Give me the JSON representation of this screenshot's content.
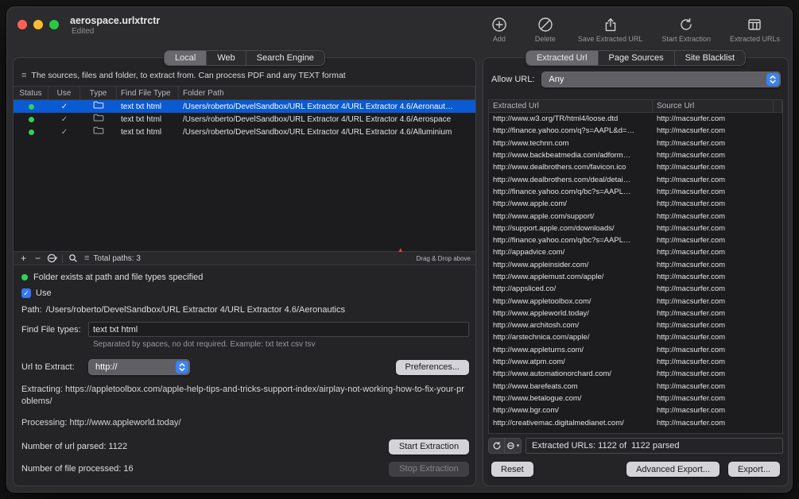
{
  "colors": {
    "accent_blue": "#3478f6",
    "selection_blue": "#0a5ad1",
    "status_green": "#30d158",
    "traffic_red": "#ff5f57",
    "traffic_yellow": "#febc2e",
    "traffic_green": "#28c840"
  },
  "window": {
    "title": "aerospace.urlxtrctr",
    "subtitle": "Edited"
  },
  "toolbar": {
    "items": [
      {
        "label": "Add",
        "icon": "plus-circle-icon"
      },
      {
        "label": "Delete",
        "icon": "slash-circle-icon"
      },
      {
        "label": "Save Extracted URL",
        "icon": "share-icon"
      },
      {
        "label": "Start Extraction",
        "icon": "refresh-icon"
      },
      {
        "label": "Extracted URLs",
        "icon": "table-columns-icon"
      }
    ]
  },
  "left_panel": {
    "tabs": [
      "Local",
      "Web",
      "Search Engine"
    ],
    "active_tab": "Local",
    "description": "The sources, files and folder, to extract from. Can process PDF and any TEXT format",
    "table": {
      "columns": [
        "Status",
        "Use",
        "Type",
        "Find File Type",
        "Folder Path"
      ],
      "rows": [
        {
          "status": "green",
          "use": true,
          "type": "folder",
          "find_file_type": "text txt html",
          "folder_path": "/Users/roberto/DevelSandbox/URL Extractor 4/URL Extractor 4.6/Aeronaut…",
          "selected": true
        },
        {
          "status": "green",
          "use": true,
          "type": "folder",
          "find_file_type": "text txt html",
          "folder_path": "/Users/roberto/DevelSandbox/URL Extractor 4/URL Extractor 4.6/Aerospace",
          "selected": false
        },
        {
          "status": "green",
          "use": true,
          "type": "folder",
          "find_file_type": "text txt html",
          "folder_path": "/Users/roberto/DevelSandbox/URL Extractor 4/URL Extractor 4.6/Alluminium",
          "selected": false
        }
      ]
    },
    "footer": {
      "tools": [
        "plus-icon",
        "minus-icon",
        "remove-circle-icon",
        "search-icon"
      ],
      "total_paths": "Total paths: 3",
      "drag_hint": "Drag & Drop above"
    },
    "status_line": "Folder exists at path and file types specified",
    "use_label": "Use",
    "use_checked": true,
    "path_label": "Path:",
    "path_value": "/Users/roberto/DevelSandbox/URL Extractor 4/URL Extractor 4.6/Aeronautics",
    "find_file_types_label": "Find File types:",
    "find_file_types_value": "text txt html",
    "find_file_types_hint": "Separated by spaces, no dot required. Example: txt text csv tsv",
    "url_to_extract_label": "Url to Extract:",
    "url_scheme_value": "http://",
    "preferences_button": "Preferences...",
    "extracting_line": "Extracting: https://appletoolbox.com/apple-help-tips-and-tricks-support-index/airplay-not-working-how-to-fix-your-problems/",
    "processing_line": "Processing: http://www.appleworld.today/",
    "url_parsed_line": "Number of url parsed: 1122",
    "file_processed_line": "Number of file processed: 16",
    "start_button": "Start Extraction",
    "stop_button": "Stop Extraction"
  },
  "right_panel": {
    "tabs": [
      "Extracted Url",
      "Page Sources",
      "Site Blacklist"
    ],
    "active_tab": "Extracted Url",
    "allow_url_label": "Allow URL:",
    "allow_url_value": "Any",
    "table": {
      "columns": [
        "Extracted Url",
        "Source Url"
      ],
      "rows": [
        {
          "extracted": "http://www.w3.org/TR/html4/loose.dtd",
          "source": "http://macsurfer.com"
        },
        {
          "extracted": "http://finance.yahoo.com/q?s=AAPL&d=…",
          "source": "http://macsurfer.com"
        },
        {
          "extracted": "http://www.technn.com",
          "source": "http://macsurfer.com"
        },
        {
          "extracted": "http://www.backbeatmedia.com/adform…",
          "source": "http://macsurfer.com"
        },
        {
          "extracted": "http://www.dealbrothers.com/favicon.ico",
          "source": "http://macsurfer.com"
        },
        {
          "extracted": "http://www.dealbrothers.com/deal/detai…",
          "source": "http://macsurfer.com"
        },
        {
          "extracted": "http://finance.yahoo.com/q/bc?s=AAPL…",
          "source": "http://macsurfer.com"
        },
        {
          "extracted": "http://www.apple.com/",
          "source": "http://macsurfer.com"
        },
        {
          "extracted": "http://www.apple.com/support/",
          "source": "http://macsurfer.com"
        },
        {
          "extracted": "http://support.apple.com/downloads/",
          "source": "http://macsurfer.com"
        },
        {
          "extracted": "http://finance.yahoo.com/q/bc?s=AAPL…",
          "source": "http://macsurfer.com"
        },
        {
          "extracted": "http://appadvice.com/",
          "source": "http://macsurfer.com"
        },
        {
          "extracted": "http://www.appleinsider.com/",
          "source": "http://macsurfer.com"
        },
        {
          "extracted": "http://www.applemust.com/apple/",
          "source": "http://macsurfer.com"
        },
        {
          "extracted": "http://appsliced.co/",
          "source": "http://macsurfer.com"
        },
        {
          "extracted": "http://www.appletoolbox.com/",
          "source": "http://macsurfer.com"
        },
        {
          "extracted": "http://www.appleworld.today/",
          "source": "http://macsurfer.com"
        },
        {
          "extracted": "http://www.architosh.com/",
          "source": "http://macsurfer.com"
        },
        {
          "extracted": "http://arstechnica.com/apple/",
          "source": "http://macsurfer.com"
        },
        {
          "extracted": "http://www.appleturns.com/",
          "source": "http://macsurfer.com"
        },
        {
          "extracted": "http://www.atpm.com/",
          "source": "http://macsurfer.com"
        },
        {
          "extracted": "http://www.automationorchard.com/",
          "source": "http://macsurfer.com"
        },
        {
          "extracted": "http://www.barefeats.com",
          "source": "http://macsurfer.com"
        },
        {
          "extracted": "http://www.betalogue.com/",
          "source": "http://macsurfer.com"
        },
        {
          "extracted": "http://www.bgr.com/",
          "source": "http://macsurfer.com"
        },
        {
          "extracted": "http://creativemac.digitalmedianet.com/",
          "source": "http://macsurfer.com"
        }
      ]
    },
    "status_tools": [
      "refresh-icon",
      "remove-circle-icon"
    ],
    "status_bar": "Extracted URLs: 1122 of  1122 parsed",
    "reset_button": "Reset",
    "advanced_export_button": "Advanced Export...",
    "export_button": "Export..."
  }
}
